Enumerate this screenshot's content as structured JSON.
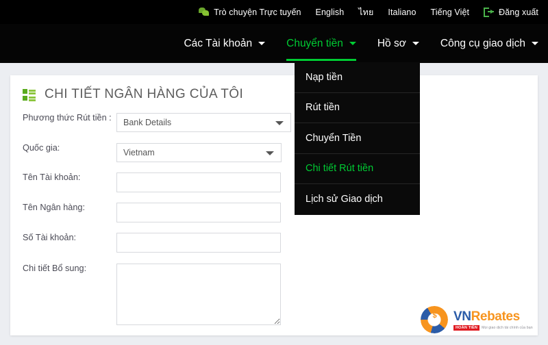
{
  "topbar": {
    "chat_icon": "chat-bubble-icon",
    "chat_label": "Trò chuyện Trực tuyến",
    "languages": [
      "English",
      "ไทย",
      "Italiano",
      "Tiếng Việt"
    ],
    "logout_icon": "logout-icon",
    "logout_label": "Đăng xuất"
  },
  "nav": {
    "items": [
      {
        "label": "Các Tài khoản",
        "active": false,
        "has_caret": true
      },
      {
        "label": "Chuyển tiền",
        "active": true,
        "has_caret": true
      },
      {
        "label": "Hồ sơ",
        "active": false,
        "has_caret": true
      },
      {
        "label": "Công cụ giao dịch",
        "active": false,
        "has_caret": true
      }
    ],
    "accent_color": "#00cc33"
  },
  "dropdown": {
    "open_under": "Chuyển tiền",
    "items": [
      {
        "label": "Nạp tiền",
        "active": false
      },
      {
        "label": "Rút tiền",
        "active": false
      },
      {
        "label": "Chuyển Tiền",
        "active": false
      },
      {
        "label": "Chi tiết Rút tiền",
        "active": true
      },
      {
        "label": "Lịch sử Giao dịch",
        "active": false
      }
    ]
  },
  "page": {
    "title_icon": "list-grid-icon",
    "title": "CHI TIẾT NGÂN HÀNG CỦA TÔI"
  },
  "form": {
    "fields": [
      {
        "label": "Phương thức Rút tiền :",
        "type": "select",
        "value": "Bank Details"
      },
      {
        "label": "Quốc gia:",
        "type": "select",
        "value": "Vietnam"
      },
      {
        "label": "Tên Tài khoản:",
        "type": "text",
        "value": ""
      },
      {
        "label": "Tên Ngân hàng:",
        "type": "text",
        "value": ""
      },
      {
        "label": "Số Tài khoản:",
        "type": "text",
        "value": ""
      },
      {
        "label": "Chi tiết Bổ sung:",
        "type": "textarea",
        "value": ""
      }
    ]
  },
  "logo": {
    "mark": "vnrebates-swirl-icon",
    "mark_symbol": "$",
    "name_first": "VN",
    "name_second": "Rebates",
    "badge": "HOÀN TIỀN",
    "tagline": "Mọi giao dịch tài chính của bạn"
  }
}
